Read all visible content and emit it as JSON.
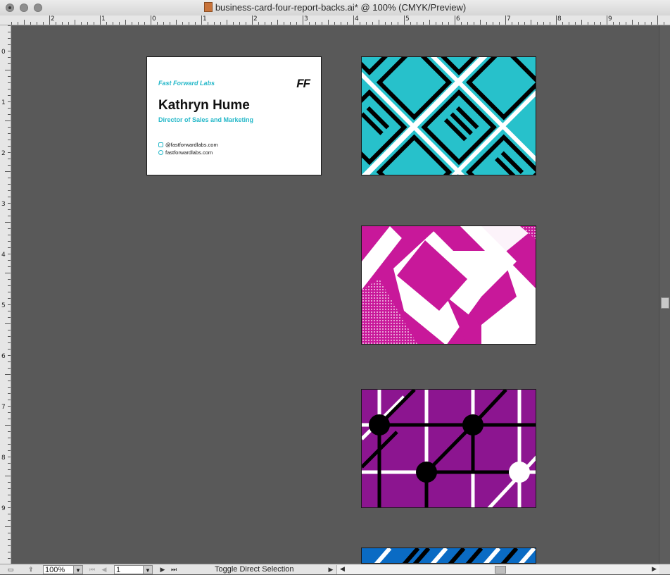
{
  "window": {
    "title": "business-card-four-report-backs.ai* @ 100% (CMYK/Preview)"
  },
  "ruler": {
    "top_labels": [
      "2",
      "1",
      "0",
      "1",
      "2",
      "3",
      "4",
      "5",
      "6",
      "7",
      "8",
      "9"
    ],
    "left_labels": [
      "0",
      "1",
      "2",
      "3",
      "4",
      "5",
      "6",
      "7",
      "8",
      "9"
    ]
  },
  "card_front": {
    "brand": "Fast Forward Labs",
    "logo": "FF",
    "name": "Kathryn Hume",
    "role": "Director of Sales and Marketing",
    "email": "@fastforwardlabs.com",
    "website": "fastforwardlabs.com",
    "accent_color": "#25b8c9"
  },
  "card_backs": [
    {
      "pattern": "cyan-maze",
      "color": "#27c1cb"
    },
    {
      "pattern": "magenta-chevron",
      "color": "#c8189a"
    },
    {
      "pattern": "purple-network",
      "color": "#8c1590"
    },
    {
      "pattern": "blue-stripes",
      "color": "#0a6bc4"
    }
  ],
  "status": {
    "zoom": "100%",
    "artboard": "1",
    "tool": "Toggle Direct Selection"
  }
}
